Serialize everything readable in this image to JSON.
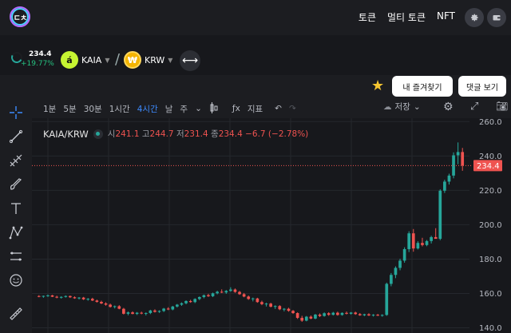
{
  "header": {
    "logo_text": "ㄷㅊ",
    "nav": [
      "토큰",
      "멀티 토큰",
      "NFT"
    ],
    "icons": [
      "gear-icon",
      "wallet-icon"
    ]
  },
  "pair": {
    "mini_price": "234.4",
    "mini_change": "+19.77%",
    "base": {
      "symbol": "KAIA",
      "icon_letter": "á",
      "color": "#c6f432"
    },
    "quote": {
      "symbol": "KRW",
      "icon_letter": "₩",
      "color": "#f4b400"
    },
    "separator": "/"
  },
  "actions": {
    "favorite": "내 즐겨찾기",
    "comments": "댓글 보기"
  },
  "toolbar": {
    "timeframes": [
      "1분",
      "5분",
      "30분",
      "1시간",
      "4시간",
      "날",
      "주"
    ],
    "active_timeframe": "4시간",
    "indicators_label": "지표",
    "save_label": "저장"
  },
  "legend": {
    "symbol": "KAIA/KRW",
    "o_label": "시",
    "o": "241.1",
    "h_label": "고",
    "h": "244.7",
    "l_label": "저",
    "l": "231.4",
    "c_label": "종",
    "c": "234.4",
    "change": "−6.7 (−2.78%)"
  },
  "chart_data": {
    "type": "candlestick",
    "pair": "KAIA/KRW",
    "y_ticks": [
      140.0,
      160.0,
      180.0,
      200.0,
      220.0,
      240.0,
      260.0
    ],
    "ylim": [
      137,
      262
    ],
    "last_price": 234.4,
    "last_price_label": "234.4",
    "colors": {
      "up": "#26a69a",
      "down": "#ef5350"
    },
    "candles": [
      [
        158.5,
        159.0,
        157.8,
        158.2
      ],
      [
        158.2,
        158.8,
        157.5,
        158.6
      ],
      [
        158.6,
        159.4,
        158.0,
        158.9
      ],
      [
        158.9,
        159.2,
        157.9,
        158.1
      ],
      [
        158.1,
        158.7,
        157.2,
        157.6
      ],
      [
        157.6,
        158.4,
        157.0,
        158.0
      ],
      [
        158.0,
        158.9,
        157.6,
        158.5
      ],
      [
        158.5,
        158.8,
        157.4,
        157.8
      ],
      [
        157.8,
        158.3,
        156.9,
        157.2
      ],
      [
        157.2,
        157.9,
        156.5,
        157.6
      ],
      [
        157.6,
        158.0,
        156.2,
        156.6
      ],
      [
        156.6,
        157.3,
        155.8,
        156.9
      ],
      [
        156.9,
        157.5,
        155.6,
        155.9
      ],
      [
        155.9,
        156.4,
        154.7,
        155.1
      ],
      [
        155.1,
        155.8,
        153.8,
        154.2
      ],
      [
        154.2,
        154.9,
        152.9,
        153.5
      ],
      [
        153.5,
        154.1,
        151.8,
        152.2
      ],
      [
        152.2,
        153.0,
        151.3,
        152.6
      ],
      [
        152.6,
        153.2,
        150.8,
        151.1
      ],
      [
        151.1,
        151.6,
        147.8,
        148.2
      ],
      [
        148.2,
        149.5,
        147.3,
        149.0
      ],
      [
        149.0,
        149.6,
        147.9,
        148.1
      ],
      [
        148.1,
        149.2,
        147.5,
        148.8
      ],
      [
        148.8,
        149.4,
        147.9,
        148.3
      ],
      [
        148.3,
        149.0,
        147.2,
        148.6
      ],
      [
        148.6,
        150.5,
        148.0,
        150.1
      ],
      [
        150.1,
        150.8,
        148.9,
        149.3
      ],
      [
        149.3,
        150.2,
        148.7,
        149.8
      ],
      [
        149.8,
        151.6,
        149.2,
        151.2
      ],
      [
        151.2,
        152.0,
        150.3,
        150.7
      ],
      [
        150.7,
        152.8,
        150.2,
        152.4
      ],
      [
        152.4,
        153.9,
        151.8,
        153.5
      ],
      [
        153.5,
        154.8,
        152.8,
        154.3
      ],
      [
        154.3,
        156.0,
        153.7,
        155.6
      ],
      [
        155.6,
        156.3,
        154.6,
        155.0
      ],
      [
        155.0,
        157.2,
        154.4,
        156.8
      ],
      [
        156.8,
        158.3,
        156.1,
        157.9
      ],
      [
        157.9,
        159.4,
        157.2,
        159.0
      ],
      [
        159.0,
        159.8,
        158.0,
        158.4
      ],
      [
        158.4,
        160.5,
        157.9,
        160.1
      ],
      [
        160.1,
        161.6,
        159.5,
        161.0
      ],
      [
        161.0,
        162.4,
        160.2,
        160.6
      ],
      [
        160.6,
        162.0,
        159.8,
        161.5
      ],
      [
        161.5,
        163.6,
        161.0,
        162.3
      ],
      [
        162.3,
        162.9,
        160.4,
        160.9
      ],
      [
        160.9,
        161.5,
        159.2,
        159.6
      ],
      [
        159.6,
        160.3,
        157.8,
        158.2
      ],
      [
        158.2,
        158.8,
        156.3,
        156.8
      ],
      [
        156.8,
        157.6,
        155.4,
        157.1
      ],
      [
        157.1,
        157.5,
        154.6,
        155.0
      ],
      [
        155.0,
        155.8,
        153.2,
        153.8
      ],
      [
        153.8,
        154.6,
        152.4,
        154.1
      ],
      [
        154.1,
        154.6,
        151.9,
        152.3
      ],
      [
        152.3,
        153.1,
        151.0,
        152.7
      ],
      [
        152.7,
        153.2,
        150.3,
        150.8
      ],
      [
        150.8,
        151.5,
        149.6,
        151.1
      ],
      [
        151.1,
        151.7,
        149.4,
        149.9
      ],
      [
        149.9,
        150.4,
        148.1,
        148.6
      ],
      [
        148.6,
        149.0,
        145.2,
        145.8
      ],
      [
        145.8,
        147.0,
        143.5,
        144.2
      ],
      [
        144.2,
        146.9,
        143.8,
        146.5
      ],
      [
        146.5,
        147.2,
        145.0,
        145.4
      ],
      [
        145.4,
        148.1,
        145.0,
        147.7
      ],
      [
        147.7,
        148.4,
        146.3,
        146.9
      ],
      [
        146.9,
        149.0,
        146.5,
        148.5
      ],
      [
        148.5,
        149.1,
        147.0,
        147.6
      ],
      [
        147.6,
        149.3,
        147.2,
        148.8
      ],
      [
        148.8,
        149.4,
        147.1,
        147.5
      ],
      [
        147.5,
        149.0,
        147.1,
        148.7
      ],
      [
        148.7,
        149.5,
        147.8,
        148.2
      ],
      [
        148.2,
        149.2,
        147.7,
        148.9
      ],
      [
        148.9,
        149.4,
        147.6,
        148.0
      ],
      [
        148.0,
        148.6,
        147.0,
        147.3
      ],
      [
        147.3,
        148.2,
        146.8,
        147.9
      ],
      [
        147.9,
        148.5,
        146.9,
        147.2
      ],
      [
        147.2,
        148.0,
        146.6,
        147.6
      ],
      [
        147.6,
        148.1,
        146.9,
        147.1
      ],
      [
        147.1,
        147.9,
        146.5,
        147.5
      ],
      [
        147.5,
        166.3,
        147.0,
        165.6
      ],
      [
        165.6,
        171.9,
        164.2,
        170.8
      ],
      [
        170.8,
        175.8,
        168.9,
        174.9
      ],
      [
        174.9,
        180.2,
        173.5,
        179.1
      ],
      [
        179.1,
        186.9,
        177.9,
        185.8
      ],
      [
        185.8,
        196.2,
        184.1,
        195.0
      ],
      [
        195.0,
        197.5,
        184.3,
        186.2
      ],
      [
        186.2,
        190.4,
        185.6,
        189.4
      ],
      [
        189.4,
        192.4,
        187.4,
        188.2
      ],
      [
        188.2,
        191.1,
        187.5,
        190.5
      ],
      [
        190.5,
        193.6,
        189.1,
        192.8
      ],
      [
        192.8,
        198.0,
        192.0,
        191.8
      ],
      [
        191.8,
        220.6,
        191.0,
        219.8
      ],
      [
        219.8,
        226.2,
        218.5,
        225.1
      ],
      [
        225.1,
        229.7,
        223.4,
        228.6
      ],
      [
        228.6,
        242.1,
        227.0,
        240.4
      ],
      [
        240.4,
        247.9,
        235.2,
        242.3
      ],
      [
        242.3,
        244.7,
        231.4,
        234.4
      ]
    ]
  }
}
